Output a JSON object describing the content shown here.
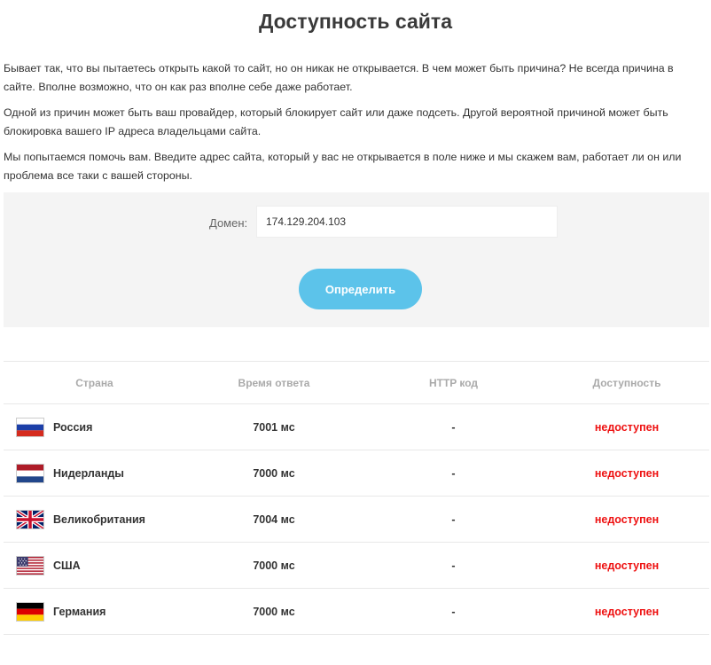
{
  "page": {
    "title": "Доступность сайта",
    "intro": [
      "Бывает так, что вы пытаетесь открыть какой то сайт, но он никак не открывается. В чем может быть причина? Не всегда причина в сайте. Вполне возможно, что он как раз вполне себе даже работает.",
      "Одной из причин может быть ваш провайдер, который блокирует сайт или даже подсеть. Другой вероятной причиной может быть блокировка вашего IP адреса владельцами сайта.",
      "Мы попытаемся помочь вам. Введите адрес сайта, который у вас не открывается в поле ниже и мы скажем вам, работает ли он или проблема все таки с вашей стороны."
    ]
  },
  "form": {
    "domain_label": "Домен:",
    "domain_value": "174.129.204.103",
    "submit_label": "Определить"
  },
  "table": {
    "headers": [
      "Страна",
      "Время ответа",
      "HTTP код",
      "Доступность"
    ],
    "rows": [
      {
        "flag": "russia-flag-icon",
        "country": "Россия",
        "time": "7001 мс",
        "code": "-",
        "status": "недоступен"
      },
      {
        "flag": "netherlands-flag-icon",
        "country": "Нидерланды",
        "time": "7000 мс",
        "code": "-",
        "status": "недоступен"
      },
      {
        "flag": "uk-flag-icon",
        "country": "Великобритания",
        "time": "7004 мс",
        "code": "-",
        "status": "недоступен"
      },
      {
        "flag": "usa-flag-icon",
        "country": "США",
        "time": "7000 мс",
        "code": "-",
        "status": "недоступен"
      },
      {
        "flag": "germany-flag-icon",
        "country": "Германия",
        "time": "7000 мс",
        "code": "-",
        "status": "недоступен"
      }
    ]
  },
  "colors": {
    "button": "#5cc3ea",
    "status_unavailable": "#ee1111",
    "form_background": "#f4f4f4"
  }
}
